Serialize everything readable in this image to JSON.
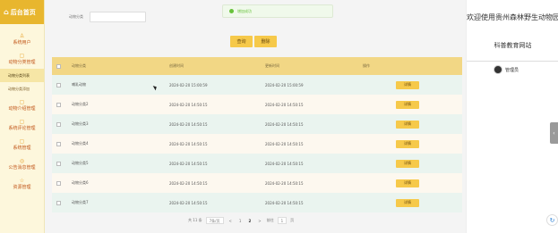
{
  "sidebar": {
    "title": "后台首页",
    "items": [
      {
        "label": "系统用户",
        "icon": "user-icon"
      },
      {
        "label": "动物分类管理",
        "icon": "folder-icon",
        "children": [
          "动物分类列表",
          "动物分类添加"
        ]
      },
      {
        "label": "动物介绍管理",
        "icon": "info-icon"
      },
      {
        "label": "系统评论管理",
        "icon": "comment-icon"
      },
      {
        "label": "系统管理",
        "icon": "gear-icon"
      },
      {
        "label": "公告消息管理",
        "icon": "bell-icon"
      },
      {
        "label": "资源管理",
        "icon": "star-icon"
      }
    ]
  },
  "search": {
    "label": "动物分类",
    "value": ""
  },
  "toast": {
    "text": "增加成功"
  },
  "buttons": {
    "query": "查询",
    "delete": "删除"
  },
  "table": {
    "headers": [
      "动物分类",
      "创建时间",
      "更新时间",
      "操作"
    ],
    "rows": [
      [
        "哺乳动物",
        "2024-02-20 15:00:59",
        "2024-02-20 15:00:59"
      ],
      [
        "动物分类2",
        "2024-02-20 14:50:15",
        "2024-02-20 14:50:15"
      ],
      [
        "动物分类3",
        "2024-02-20 14:50:15",
        "2024-02-20 14:50:15"
      ],
      [
        "动物分类4",
        "2024-02-20 14:50:15",
        "2024-02-20 14:50:15"
      ],
      [
        "动物分类5",
        "2024-02-20 14:50:15",
        "2024-02-20 14:50:15"
      ],
      [
        "动物分类6",
        "2024-02-20 14:50:15",
        "2024-02-20 14:50:15"
      ],
      [
        "动物分类7",
        "2024-02-20 14:50:15",
        "2024-02-20 14:50:15"
      ]
    ],
    "action_label": "详情"
  },
  "pager": {
    "total": "共 11 条",
    "page_size": "7条/页",
    "prev": "<",
    "pages": [
      "1",
      "2"
    ],
    "current": "2",
    "next": ">",
    "goto_label": "前往",
    "goto_value": "1",
    "page_suffix": "页"
  },
  "right_panel": {
    "welcome": "欢迎使用贵州森林野生动物园",
    "subtitle": "科普教育网站",
    "user": "管理员"
  },
  "colors": {
    "accent": "#e8b62e",
    "button": "#f6c94a",
    "sidebar_bg": "#fdf7dc",
    "success": "#67c23a"
  }
}
